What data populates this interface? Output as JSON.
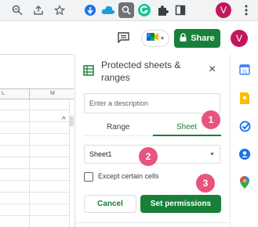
{
  "chrome": {
    "avatar_letter": "V",
    "icons": [
      "zoom-icon",
      "share-page-icon",
      "bookmark-star-icon",
      "extension-icons",
      "puzzle-icon",
      "side-panel-icon",
      "profile-avatar",
      "menu-icon"
    ]
  },
  "header": {
    "share_label": "Share",
    "avatar_letter": "V"
  },
  "grid": {
    "columns": [
      "L",
      "M"
    ]
  },
  "panel": {
    "title": "Protected sheets & ranges",
    "description_placeholder": "Enter a description",
    "tabs": [
      {
        "label": "Range",
        "active": false
      },
      {
        "label": "Sheet",
        "active": true
      }
    ],
    "selected_sheet": "Sheet1",
    "except_label": "Except certain cells",
    "cancel_label": "Cancel",
    "set_permissions_label": "Set permissions"
  },
  "callouts": [
    "1",
    "2",
    "3"
  ],
  "colors": {
    "accent_green": "#188038",
    "callout_pink": "#e8547e",
    "avatar": "#c2185b"
  }
}
